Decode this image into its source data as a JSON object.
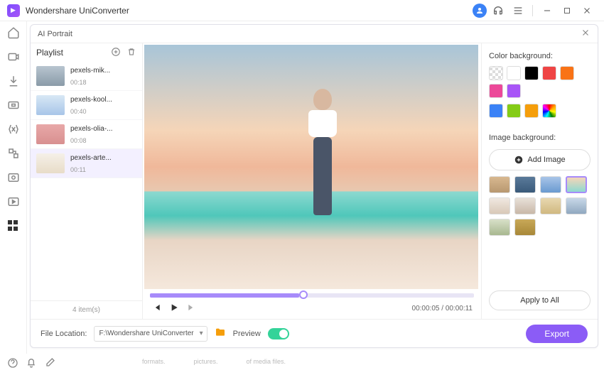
{
  "app_title": "Wondershare UniConverter",
  "dialog": {
    "title": "AI Portrait"
  },
  "playlist": {
    "header": "Playlist",
    "footer": "4 item(s)",
    "items": [
      {
        "name": "pexels-mik...",
        "duration": "00:18",
        "thumb_bg": "linear-gradient(#b8c5d0,#8a9ba8)"
      },
      {
        "name": "pexels-kool...",
        "duration": "00:40",
        "thumb_bg": "linear-gradient(#d8e8f5,#a8c5e8)"
      },
      {
        "name": "pexels-olia-...",
        "duration": "00:08",
        "thumb_bg": "linear-gradient(#e8a8a8,#d89090)"
      },
      {
        "name": "pexels-arte...",
        "duration": "00:11",
        "thumb_bg": "linear-gradient(#f5f0e8,#e8dcc8)",
        "selected": true
      }
    ]
  },
  "player": {
    "time_current": "00:00:05",
    "time_total": "00:00:11"
  },
  "panel": {
    "color_bg_label": "Color background:",
    "image_bg_label": "Image background:",
    "add_image_label": "Add Image",
    "apply_all_label": "Apply to All",
    "colors_row1": [
      {
        "name": "transparent",
        "css": "",
        "cls": "transparent"
      },
      {
        "name": "white",
        "css": "#ffffff"
      },
      {
        "name": "black",
        "css": "#000000"
      },
      {
        "name": "red",
        "css": "#ef4444"
      },
      {
        "name": "orange",
        "css": "#f97316"
      },
      {
        "name": "pink",
        "css": "#ec4899"
      },
      {
        "name": "purple",
        "css": "#a855f7"
      }
    ],
    "colors_row2": [
      {
        "name": "blue",
        "css": "#3b82f6"
      },
      {
        "name": "green",
        "css": "#84cc16"
      },
      {
        "name": "amber",
        "css": "#f59e0b"
      },
      {
        "name": "rainbow",
        "css": "",
        "cls": "rainbow"
      }
    ],
    "bg_thumbs": [
      {
        "bg": "linear-gradient(#d8b890,#b89870)"
      },
      {
        "bg": "linear-gradient(#5a7a9a,#3a5a7a)"
      },
      {
        "bg": "linear-gradient(#a8c5e8,#6a9ad0)"
      },
      {
        "bg": "linear-gradient(#f5d5b8,#8dd9d0)",
        "selected": true
      },
      {
        "bg": "linear-gradient(#f0e8e0,#d8c8b8)"
      },
      {
        "bg": "linear-gradient(#e8e0d8,#c8b8a8)"
      },
      {
        "bg": "linear-gradient(#e8d8b0,#d0b880)"
      },
      {
        "bg": "linear-gradient(#c8d8e8,#90a8c0)"
      },
      {
        "bg": "linear-gradient(#d8e0c8,#a8b890)"
      },
      {
        "bg": "linear-gradient(#c8a858,#a88838)"
      }
    ]
  },
  "footer": {
    "file_location_label": "File Location:",
    "file_location_value": "F:\\Wondershare UniConverter",
    "preview_label": "Preview",
    "export_label": "Export"
  },
  "bottom": {
    "card1": "formats.",
    "card2": "pictures.",
    "card3": "of media files."
  }
}
